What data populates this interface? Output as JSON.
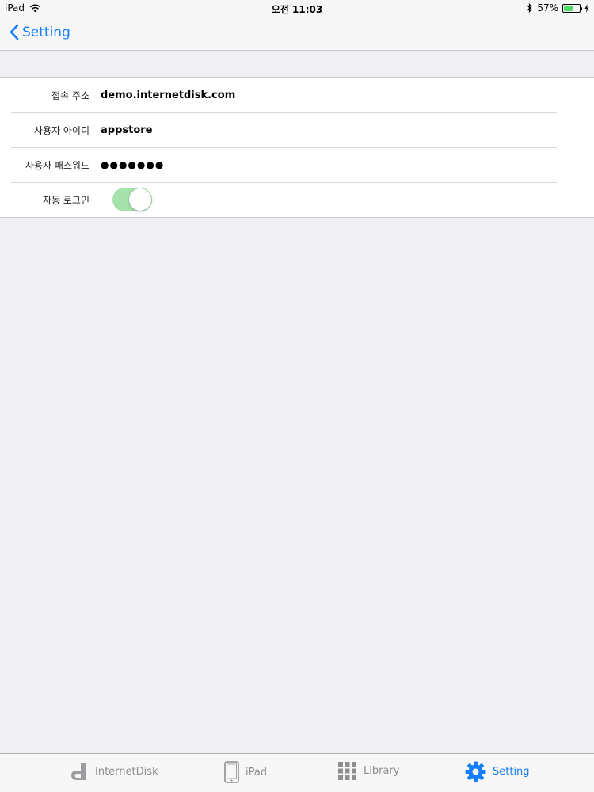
{
  "status_bar": {
    "device": "iPad",
    "time": "오전 11:03",
    "battery": "57%",
    "battery_level": 0.57
  },
  "nav": {
    "back_label": "Setting"
  },
  "settings": {
    "rows": [
      {
        "label": "접속 주소",
        "value": "demo.internetdisk.com"
      },
      {
        "label": "사용자 아이디",
        "value": "appstore"
      },
      {
        "label": "사용자 패스워드",
        "value": "●●●●●●●"
      },
      {
        "label": "자동 로그인",
        "toggle_on": true
      }
    ]
  },
  "tabs": [
    {
      "label": "InternetDisk",
      "icon": "internetdisk-logo-icon"
    },
    {
      "label": "iPad",
      "icon": "ipad-icon"
    },
    {
      "label": "Library",
      "icon": "grid-icon"
    },
    {
      "label": "Setting",
      "icon": "gear-icon",
      "active": true
    }
  ],
  "colors": {
    "accent": "#147efb",
    "toggle_on": "#a6e3ac",
    "background": "#efeff4"
  }
}
